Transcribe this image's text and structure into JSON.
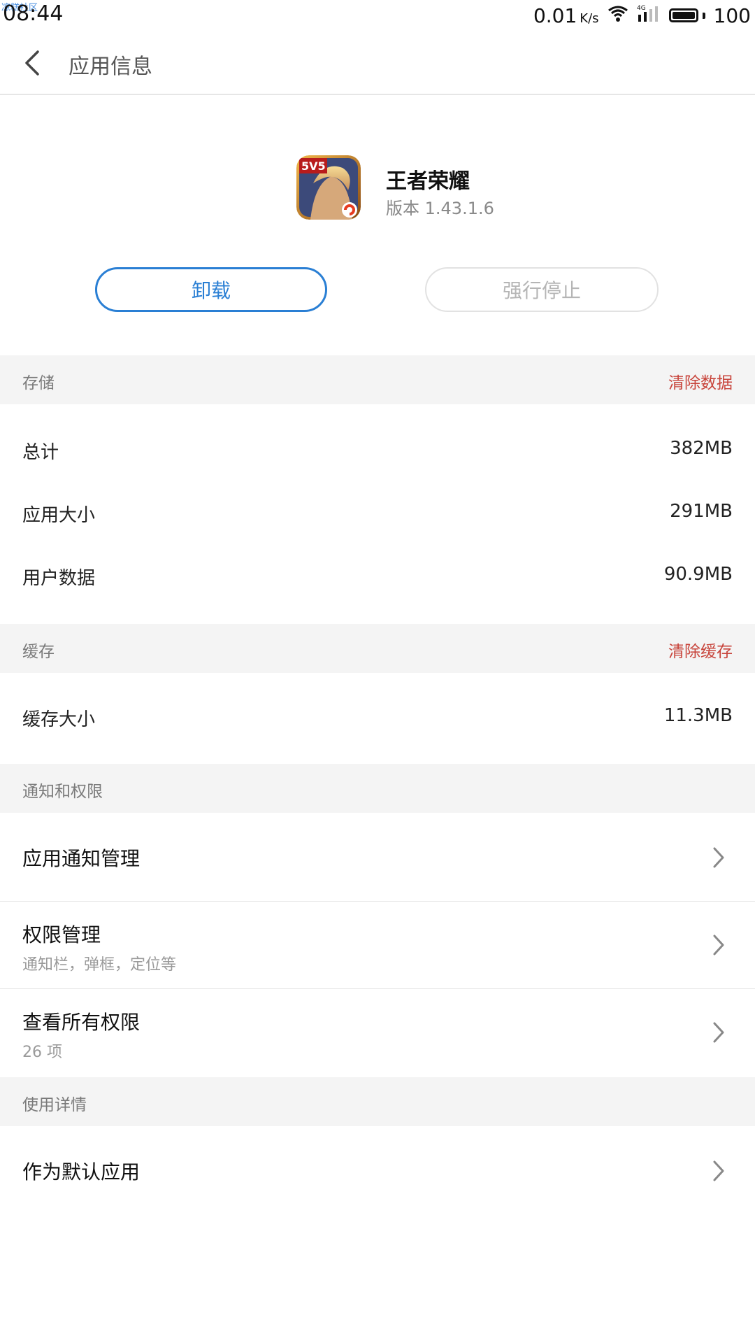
{
  "status_bar": {
    "watermark": "凉糕社区",
    "time": "08:44",
    "speed_value": "0.01",
    "speed_unit": "K/s",
    "network": "4G",
    "battery": "100"
  },
  "header": {
    "title": "应用信息"
  },
  "app": {
    "name": "王者荣耀",
    "version": "版本 1.43.1.6",
    "icon_badge": "5V5"
  },
  "actions": {
    "uninstall": "卸载",
    "force_stop": "强行停止"
  },
  "storage": {
    "section_title": "存储",
    "action": "清除数据",
    "rows": [
      {
        "label": "总计",
        "value": "382MB"
      },
      {
        "label": "应用大小",
        "value": "291MB"
      },
      {
        "label": "用户数据",
        "value": "90.9MB"
      }
    ]
  },
  "cache": {
    "section_title": "缓存",
    "action": "清除缓存",
    "rows": [
      {
        "label": "缓存大小",
        "value": "11.3MB"
      }
    ]
  },
  "permissions": {
    "section_title": "通知和权限",
    "items": [
      {
        "title": "应用通知管理",
        "subtitle": ""
      },
      {
        "title": "权限管理",
        "subtitle": "通知栏，弹框，定位等"
      },
      {
        "title": "查看所有权限",
        "subtitle": "26 项"
      }
    ]
  },
  "usage": {
    "section_title": "使用详情",
    "items": [
      {
        "title": "作为默认应用"
      }
    ]
  },
  "colors": {
    "accent_blue": "#2a7fd4",
    "danger_red": "#c8453c",
    "section_bg": "#f4f4f4",
    "muted_text": "#8a8a8a"
  },
  "icons": {
    "back": "chevron-left-icon",
    "chevron": "chevron-right-icon",
    "wifi": "wifi-icon",
    "signal": "signal-icon",
    "battery": "battery-icon"
  }
}
